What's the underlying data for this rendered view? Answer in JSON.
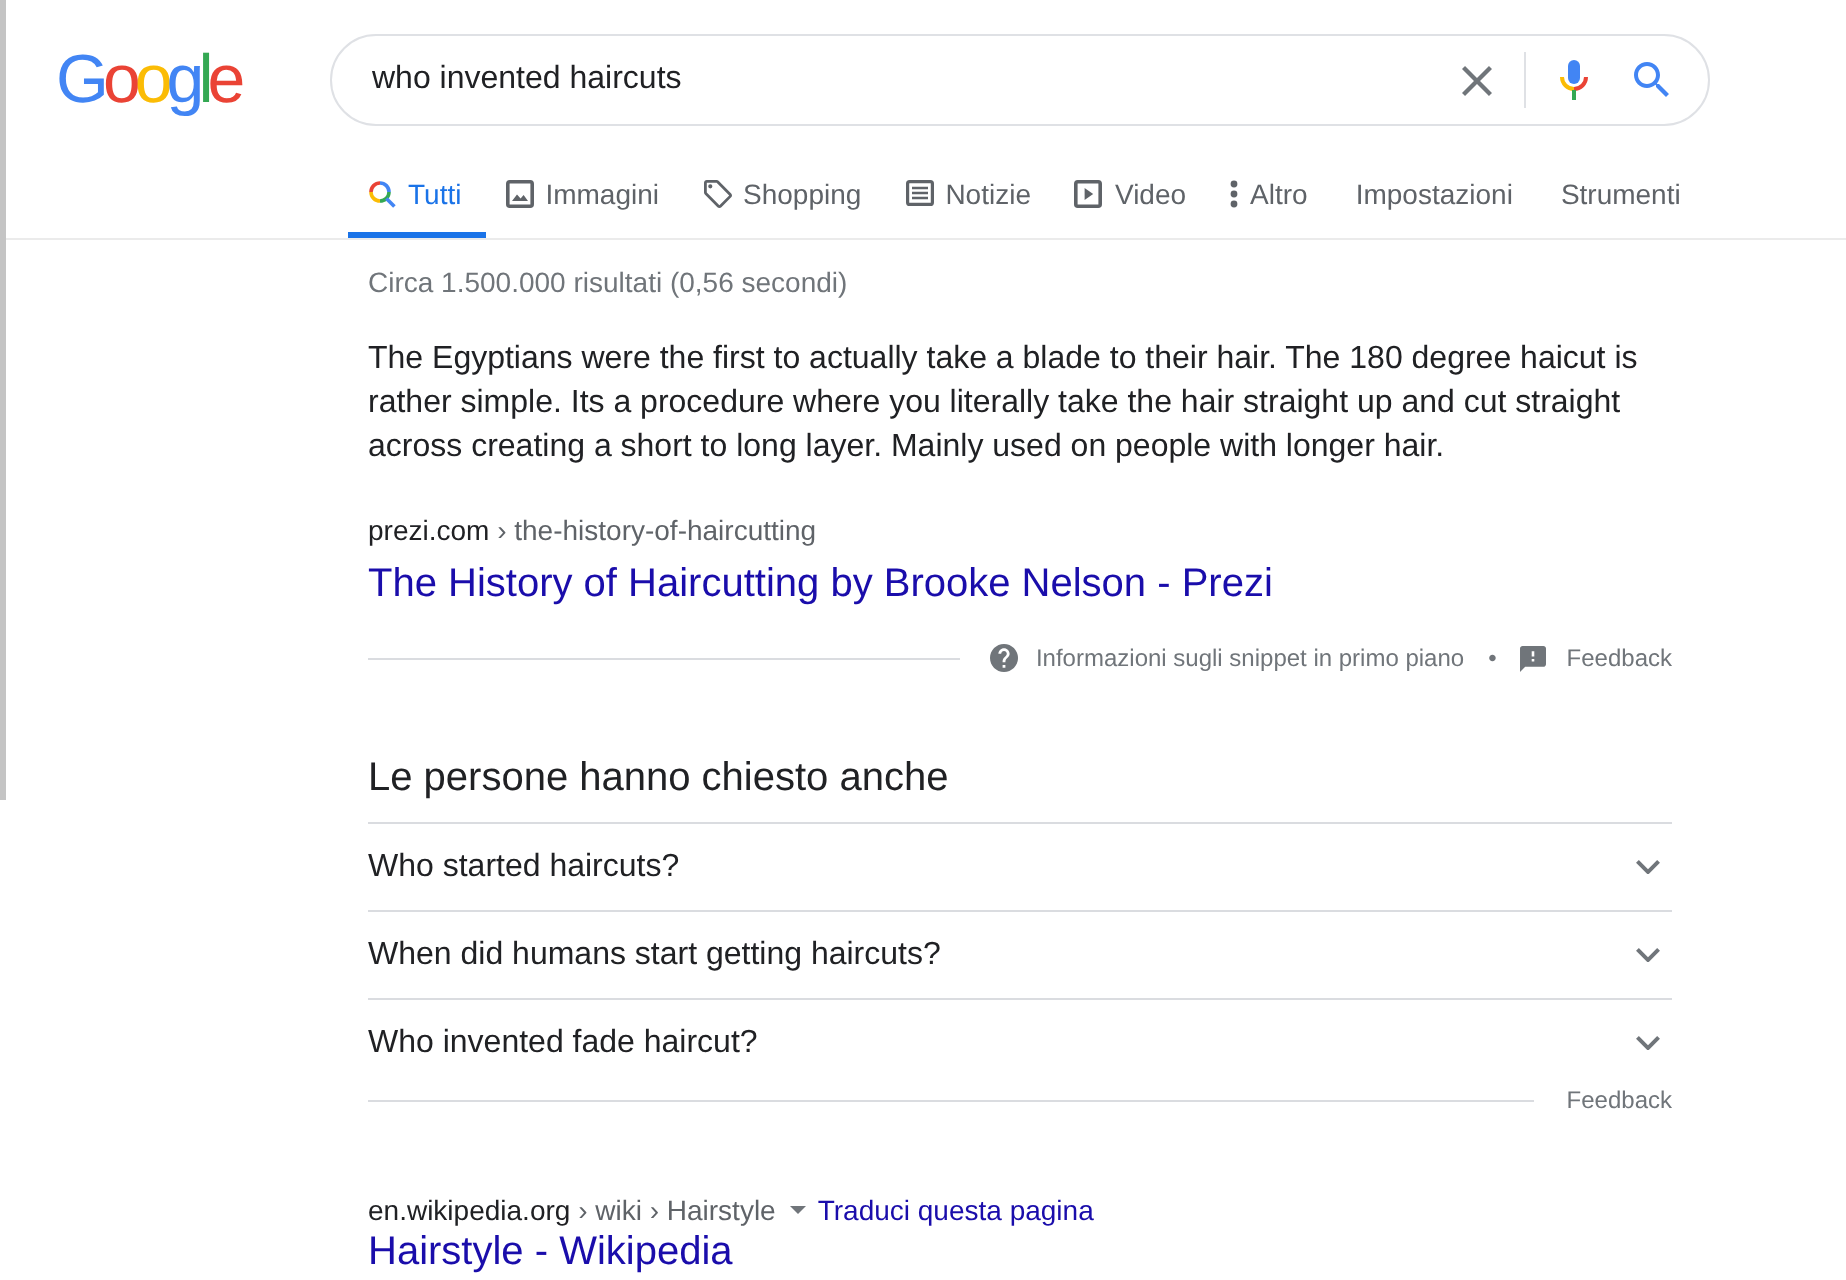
{
  "logo": {
    "text": "Google"
  },
  "search": {
    "value": "who invented haircuts"
  },
  "tabs": [
    {
      "label": "Tutti",
      "kind": "search",
      "selected": true
    },
    {
      "label": "Immagini",
      "kind": "images",
      "selected": false
    },
    {
      "label": "Shopping",
      "kind": "shopping",
      "selected": false
    },
    {
      "label": "Notizie",
      "kind": "news",
      "selected": false
    },
    {
      "label": "Video",
      "kind": "video",
      "selected": false
    },
    {
      "label": "Altro",
      "kind": "more",
      "selected": false
    }
  ],
  "tools": [
    "Impostazioni",
    "Strumenti"
  ],
  "result_stats": "Circa 1.500.000 risultati (0,56 secondi)",
  "featured_snippet": {
    "text": "The Egyptians were the first to actually take a blade to their hair. The 180 degree haicut is rather simple. Its a procedure where you literally take the hair straight up and cut straight across creating a short to long layer. Mainly used on people with longer hair.",
    "domain": "prezi.com",
    "path": "› the-history-of-haircutting",
    "title": "The History of Haircutting by Brooke Nelson - Prezi",
    "about": "Informazioni sugli snippet in primo piano",
    "separator": "•",
    "feedback": "Feedback"
  },
  "people_also_ask": {
    "title": "Le persone hanno chiesto anche",
    "questions": [
      {
        "text": "Who started haircuts?",
        "expanded": false
      },
      {
        "text": "When did humans start getting haircuts?",
        "expanded": false
      },
      {
        "text": "Who invented fade haircut?",
        "expanded": false
      }
    ],
    "feedback": "Feedback"
  },
  "results": [
    {
      "domain": "en.wikipedia.org",
      "path": "› wiki › Hairstyle",
      "translate": "Traduci questa pagina",
      "title": "Hairstyle - Wikipedia"
    }
  ]
}
